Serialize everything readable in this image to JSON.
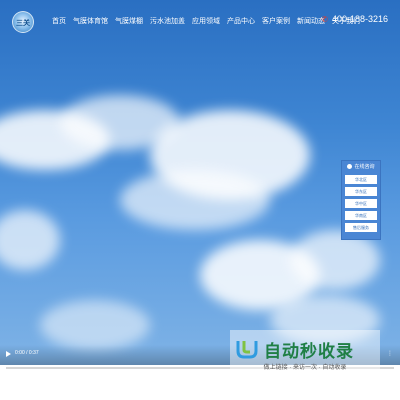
{
  "header": {
    "logo_text": "三关",
    "nav": [
      "首页",
      "气膜体育馆",
      "气膜煤棚",
      "污水池加盖",
      "应用领域",
      "产品中心",
      "客户案例",
      "新闻动态",
      "关于我们"
    ],
    "phone_icon": "phone-icon",
    "phone": "400-188-3216"
  },
  "consult": {
    "title": "在线咨询",
    "items": [
      "华北区",
      "华东区",
      "华中区",
      "华南区",
      "售后服务"
    ]
  },
  "video": {
    "time": "0:00 / 0:37",
    "progress": 0.0
  },
  "watermark": {
    "title": "自动秒收录",
    "subtitle": "做上链接 · 来访一次 · 自动收录"
  },
  "colors": {
    "accent_red": "#e03c2c",
    "consult_blue": "#4a86d4",
    "watermark_green": "#1f7f45"
  }
}
